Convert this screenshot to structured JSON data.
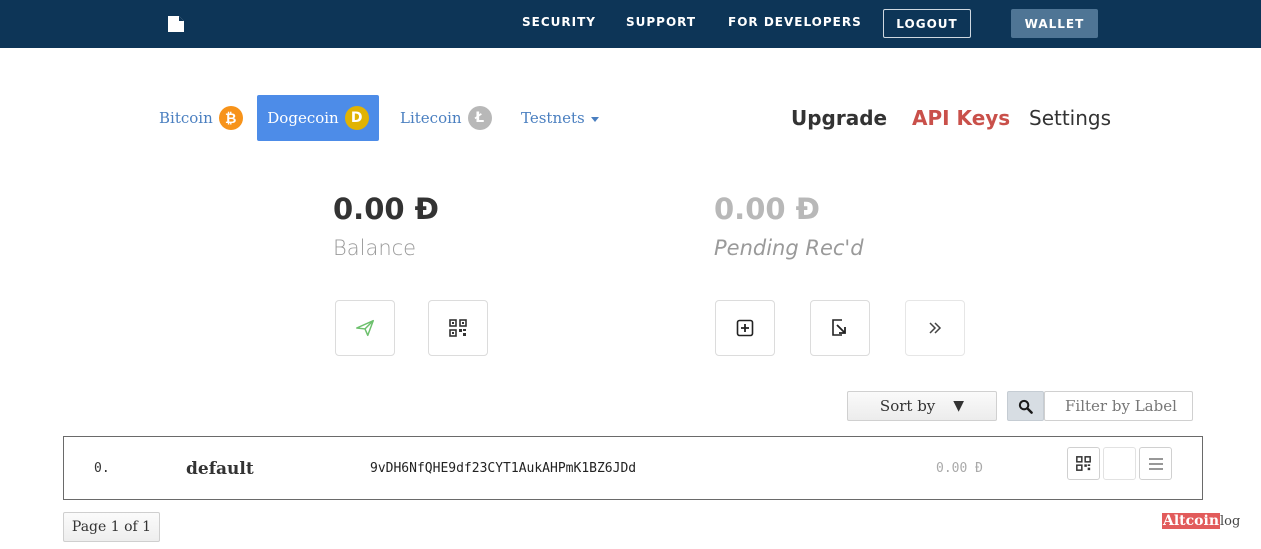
{
  "topnav": {
    "security": "SECURITY",
    "support": "SUPPORT",
    "developers": "FOR DEVELOPERS",
    "logout": "LOGOUT",
    "wallet": "WALLET"
  },
  "coins": [
    {
      "label": "Bitcoin",
      "symbol": "₿",
      "color": "#f7931a"
    },
    {
      "label": "Dogecoin",
      "symbol": "D",
      "color": "#e1b303"
    },
    {
      "label": "Litecoin",
      "symbol": "Ł",
      "color": "#b8b8b8"
    },
    {
      "label": "Testnets"
    }
  ],
  "account_links": {
    "upgrade": "Upgrade",
    "api_keys": "API Keys",
    "settings": "Settings"
  },
  "balance": {
    "amount": "0.00 Đ",
    "label": "Balance"
  },
  "pending": {
    "amount": "0.00 Đ",
    "label": "Pending Rec'd"
  },
  "controls": {
    "sort_label": "Sort by",
    "filter_placeholder": "Filter by Label"
  },
  "wallets": [
    {
      "index": "0.",
      "label": "default",
      "address": "9vDH6NfQHE9df23CYT1AukAHPmK1BZ6JDd",
      "balance": "0.00 Đ"
    }
  ],
  "pager": "Page 1 of 1",
  "watermark": {
    "part1": "Altcoin",
    "part2": "log"
  },
  "colors": {
    "topbar": "#0d3557",
    "active_tab": "#4d8ce8",
    "api_keys": "#c9504a",
    "send_icon": "#6cc06c"
  }
}
